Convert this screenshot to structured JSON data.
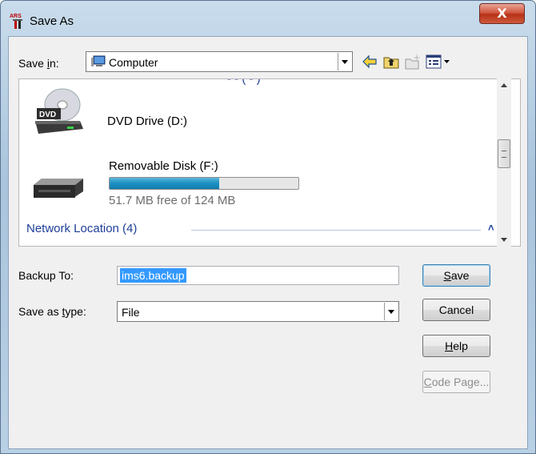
{
  "window": {
    "title": "Save As",
    "close_glyph": "X"
  },
  "toolbar": {
    "save_in_label": "Save in:",
    "save_in_value": "Computer",
    "icons": [
      "back-arrow-icon",
      "up-folder-icon",
      "new-folder-icon",
      "view-menu-icon"
    ]
  },
  "file_list": {
    "truncated_group_header": "- - ( - )",
    "items": [
      {
        "label": "DVD Drive (D:)",
        "icon": "dvd-drive-icon"
      },
      {
        "label": "Removable Disk (F:)",
        "icon": "removable-disk-icon",
        "free_text": "51.7 MB free of 124 MB",
        "used_fraction": 0.58
      }
    ],
    "network_group": {
      "label": "Network Location (4)",
      "chevron": "˄"
    }
  },
  "form": {
    "backup_to_label": "Backup To:",
    "backup_to_value": "ims6.backup",
    "save_as_type_label": "Save as type:",
    "save_as_type_value": "File"
  },
  "buttons": {
    "save": "Save",
    "cancel": "Cancel",
    "help": "Help",
    "code_page": "Code Page..."
  },
  "colors": {
    "selection": "#3399ff",
    "group_header": "#1e3f9a",
    "progress_fill": "#1c8fc1"
  }
}
